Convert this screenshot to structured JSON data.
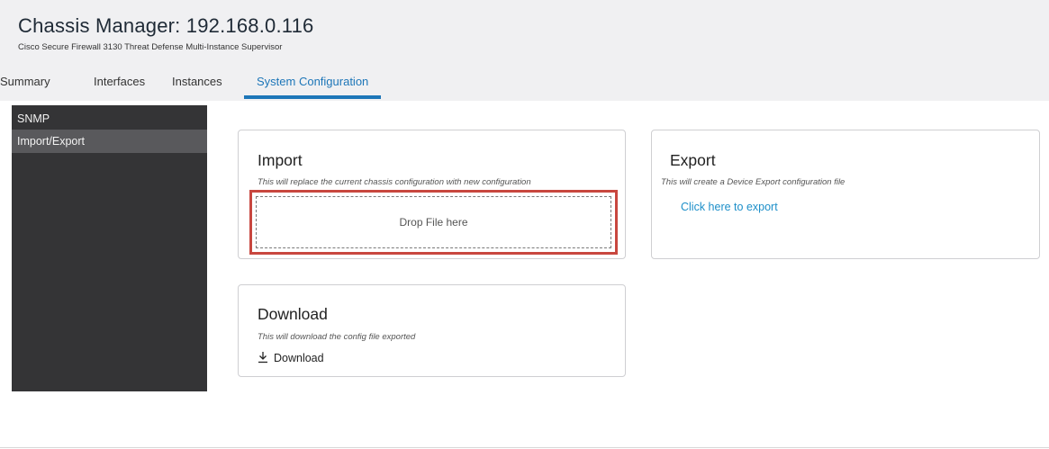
{
  "header": {
    "title": "Chassis Manager: 192.168.0.116",
    "subtitle": "Cisco Secure Firewall 3130 Threat Defense Multi-Instance Supervisor"
  },
  "tabs": [
    {
      "label": "Summary",
      "active": false
    },
    {
      "label": "Interfaces",
      "active": false
    },
    {
      "label": "Instances",
      "active": false
    },
    {
      "label": "System Configuration",
      "active": true
    }
  ],
  "sidebar": {
    "items": [
      {
        "label": "SNMP",
        "selected": false
      },
      {
        "label": "Import/Export",
        "selected": true
      }
    ]
  },
  "import_card": {
    "title": "Import",
    "description": "This will replace the current chassis configuration with new configuration",
    "dropzone_label": "Drop File here"
  },
  "export_card": {
    "title": "Export",
    "description": "This will create a Device Export configuration file",
    "link_label": "Click here to export"
  },
  "download_card": {
    "title": "Download",
    "description": "This will download the config file exported",
    "button_label": "Download",
    "button_icon": "download-icon"
  },
  "colors": {
    "accent": "#1d76b8",
    "link": "#1d8fc9",
    "highlight": "#c8473f",
    "sidebar_bg": "#343436",
    "sidebar_selected": "#59595c",
    "header_bg": "#f0f0f2"
  }
}
